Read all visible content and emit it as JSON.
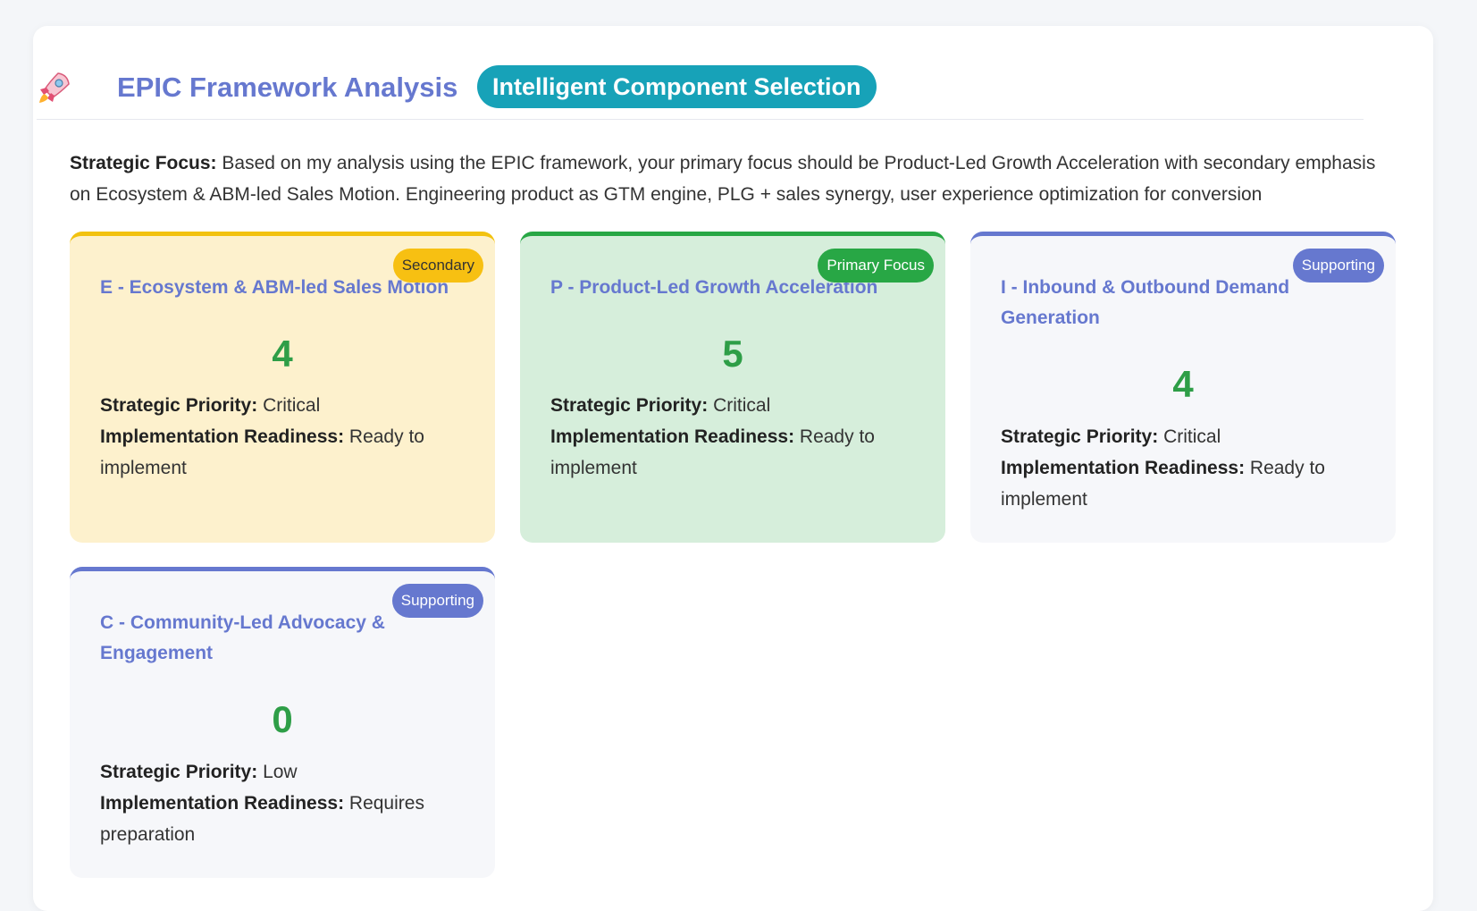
{
  "header": {
    "title": "EPIC Framework Analysis",
    "pill": "Intelligent Component Selection",
    "icon": "rocket-icon"
  },
  "summary": {
    "label": "Strategic Focus:",
    "text": "Based on my analysis using the EPIC framework, your primary focus should be Product-Led Growth Acceleration with secondary emphasis on Ecosystem & ABM-led Sales Motion. Engineering product as GTM engine, PLG + sales synergy, user experience optimization for conversion"
  },
  "labels": {
    "priority": "Strategic Priority:",
    "readiness": "Implementation Readiness:"
  },
  "colors": {
    "accent": "#6678cf",
    "pill": "#17a2b8",
    "score": "#2e9e47",
    "secondary": "#f2c20f",
    "primary": "#28a745"
  },
  "cards": [
    {
      "title": "E - Ecosystem & ABM-led Sales Motion",
      "badge": "Secondary",
      "score": "4",
      "priority": "Critical",
      "readiness": "Ready to implement"
    },
    {
      "title": "P - Product-Led Growth Acceleration",
      "badge": "Primary Focus",
      "score": "5",
      "priority": "Critical",
      "readiness": "Ready to implement"
    },
    {
      "title": "I - Inbound & Outbound Demand Generation",
      "badge": "Supporting",
      "score": "4",
      "priority": "Critical",
      "readiness": "Ready to implement"
    },
    {
      "title": "C - Community-Led Advocacy & Engagement",
      "badge": "Supporting",
      "score": "0",
      "priority": "Low",
      "readiness": "Requires preparation"
    }
  ]
}
